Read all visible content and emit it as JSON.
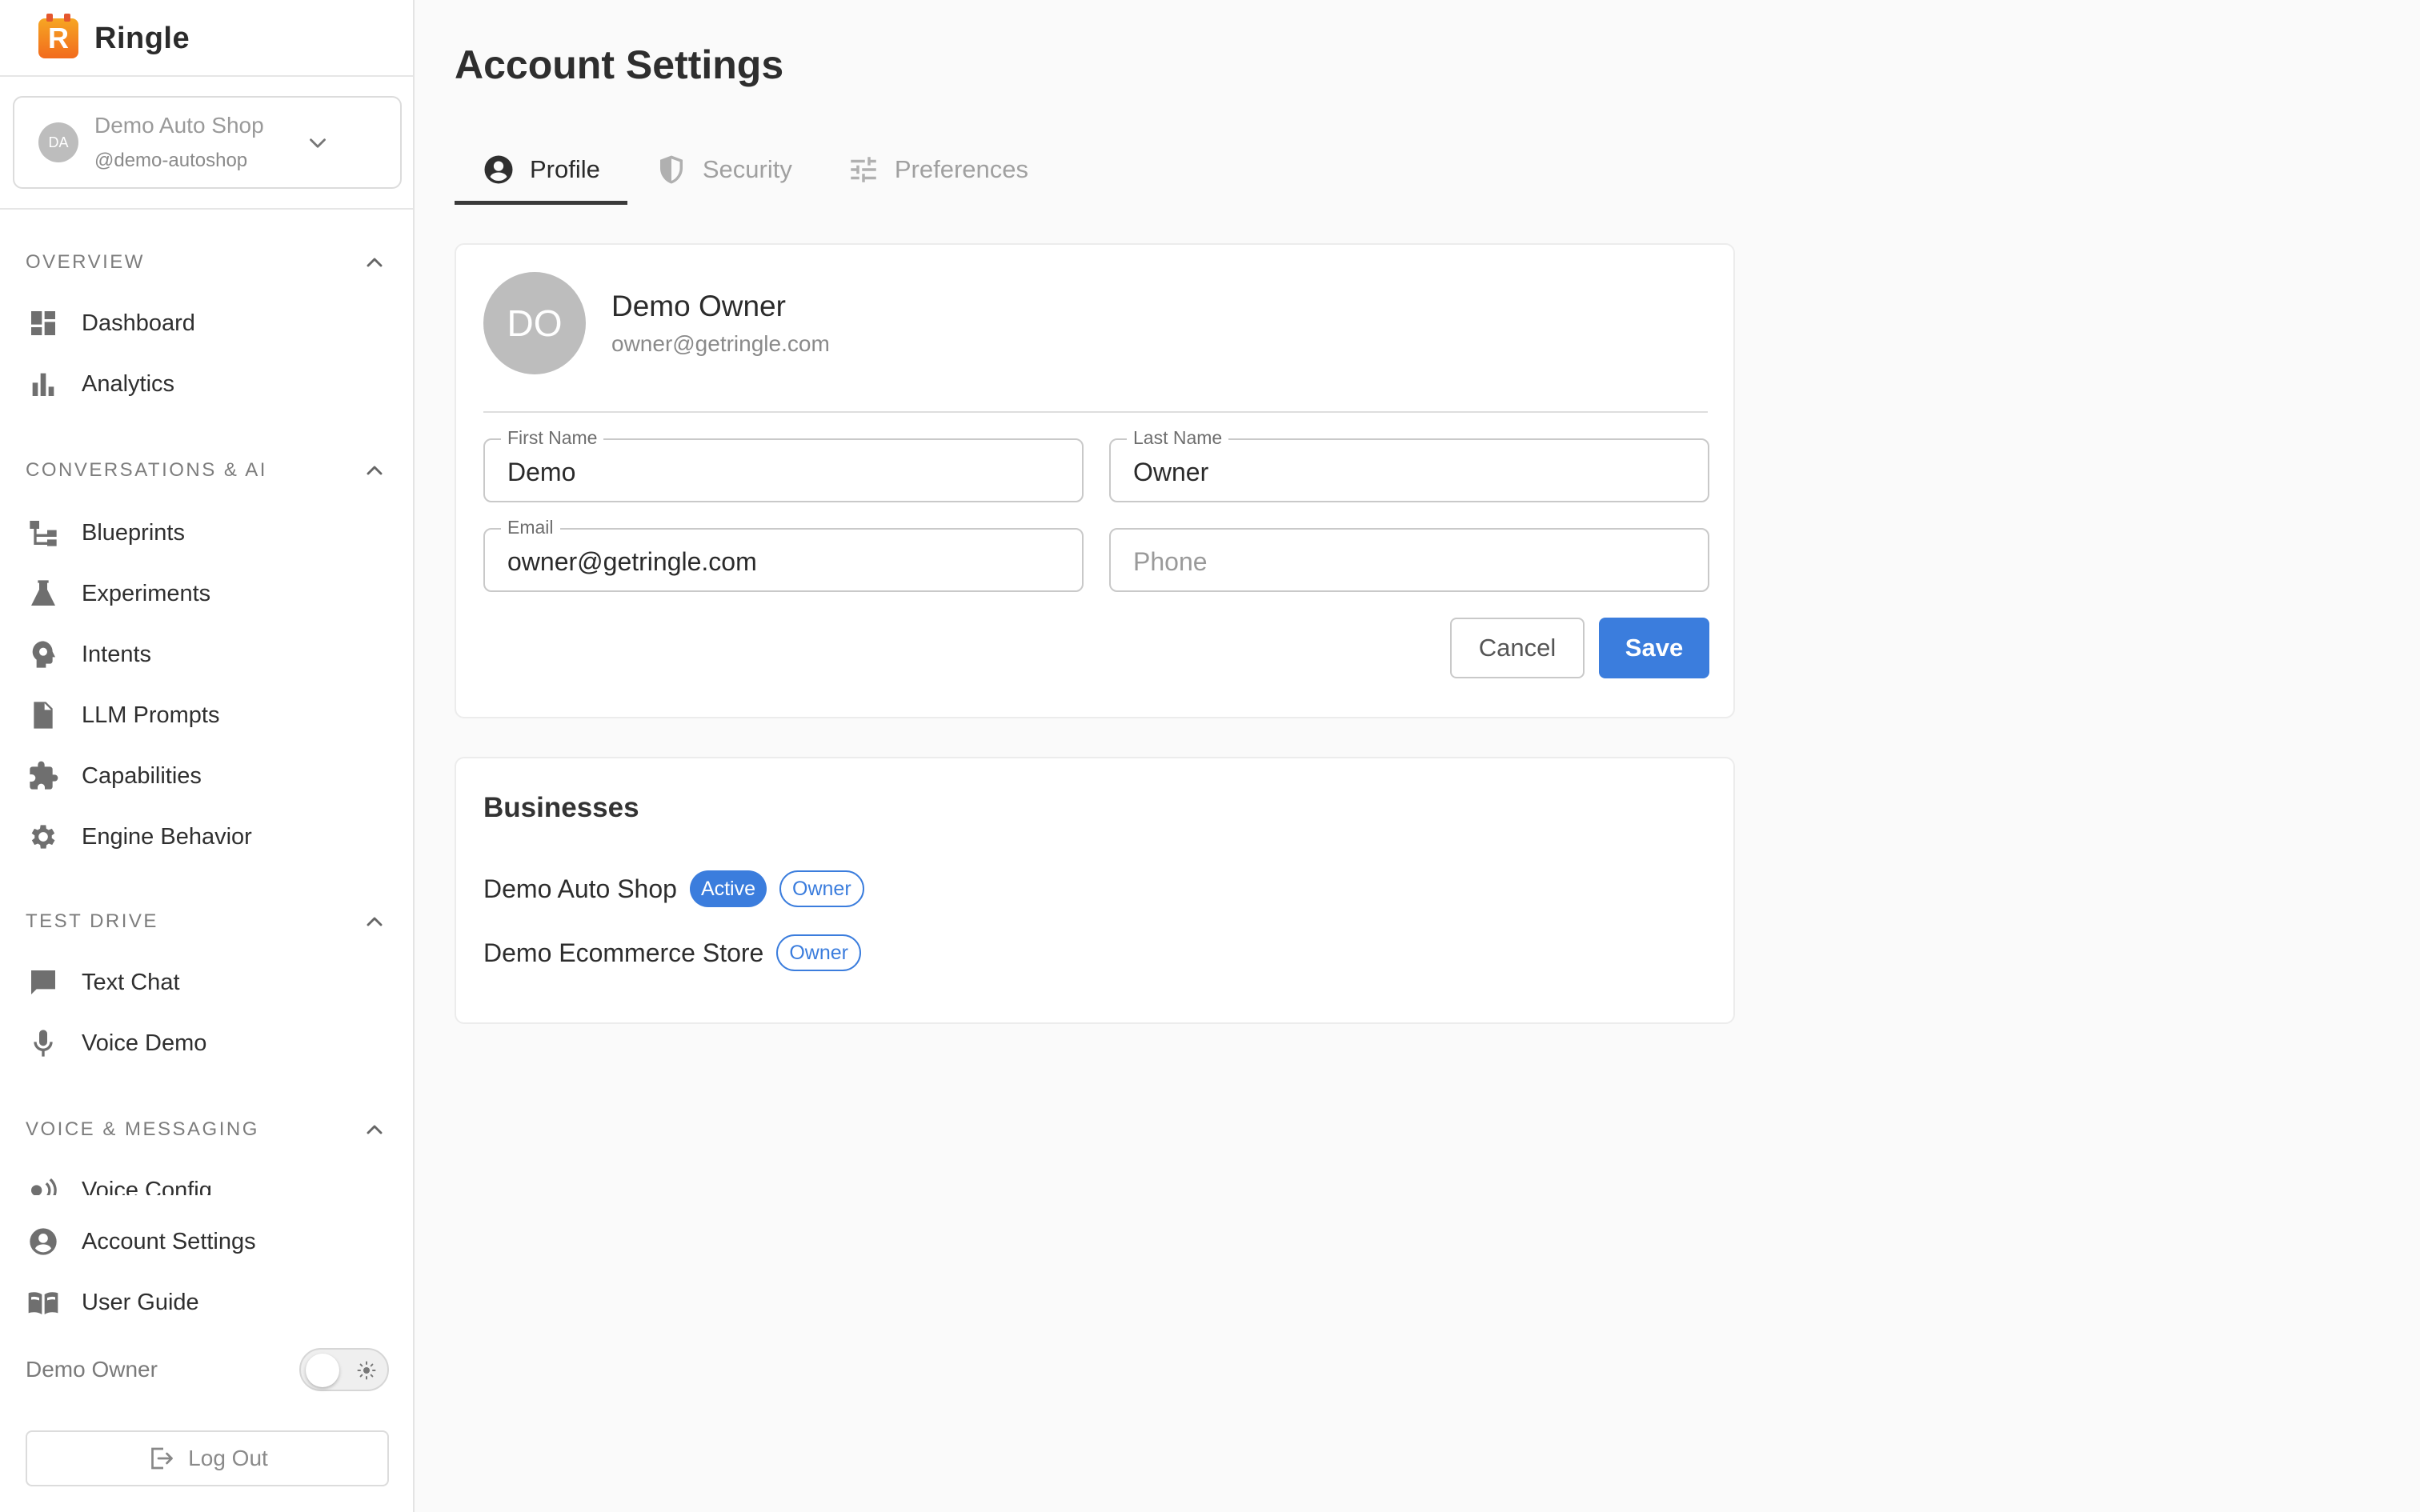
{
  "brand": {
    "name": "Ringle",
    "logo_letter": "R"
  },
  "business_selector": {
    "avatar_initials": "DA",
    "name": "Demo Auto Shop",
    "handle": "@demo-autoshop"
  },
  "sidebar": {
    "sections": [
      {
        "title": "OVERVIEW",
        "items": [
          {
            "label": "Dashboard",
            "icon": "dashboard-icon"
          },
          {
            "label": "Analytics",
            "icon": "bar-chart-icon"
          }
        ]
      },
      {
        "title": "CONVERSATIONS & AI",
        "items": [
          {
            "label": "Blueprints",
            "icon": "tree-icon"
          },
          {
            "label": "Experiments",
            "icon": "flask-icon"
          },
          {
            "label": "Intents",
            "icon": "brain-icon"
          },
          {
            "label": "LLM Prompts",
            "icon": "document-icon"
          },
          {
            "label": "Capabilities",
            "icon": "puzzle-icon"
          },
          {
            "label": "Engine Behavior",
            "icon": "gear-icon"
          }
        ]
      },
      {
        "title": "TEST DRIVE",
        "items": [
          {
            "label": "Text Chat",
            "icon": "chat-icon"
          },
          {
            "label": "Voice Demo",
            "icon": "microphone-icon"
          }
        ]
      },
      {
        "title": "VOICE & MESSAGING",
        "items": [
          {
            "label": "Voice Config",
            "icon": "voice-icon"
          }
        ]
      }
    ],
    "bottom_items": [
      {
        "label": "Account Settings",
        "icon": "account-circle-icon"
      },
      {
        "label": "User Guide",
        "icon": "book-icon"
      }
    ],
    "user_name": "Demo Owner",
    "theme": "light",
    "logout_label": "Log Out"
  },
  "page": {
    "title": "Account Settings",
    "tabs": [
      {
        "label": "Profile",
        "active": true
      },
      {
        "label": "Security",
        "active": false
      },
      {
        "label": "Preferences",
        "active": false
      }
    ]
  },
  "profile": {
    "avatar_initials": "DO",
    "name": "Demo Owner",
    "email": "owner@getringle.com",
    "fields": {
      "first_name": {
        "label": "First Name",
        "value": "Demo"
      },
      "last_name": {
        "label": "Last Name",
        "value": "Owner"
      },
      "email": {
        "label": "Email",
        "value": "owner@getringle.com"
      },
      "phone": {
        "placeholder": "Phone",
        "value": ""
      }
    },
    "cancel_label": "Cancel",
    "save_label": "Save"
  },
  "businesses": {
    "title": "Businesses",
    "items": [
      {
        "name": "Demo Auto Shop",
        "badges": [
          "Active",
          "Owner"
        ]
      },
      {
        "name": "Demo Ecommerce Store",
        "badges": [
          "Owner"
        ]
      }
    ]
  },
  "colors": {
    "accent": "#3b7ddd",
    "brand_orange": "#f26b1d",
    "background": "#fafafa",
    "sidebar_bg": "#ffffff"
  }
}
